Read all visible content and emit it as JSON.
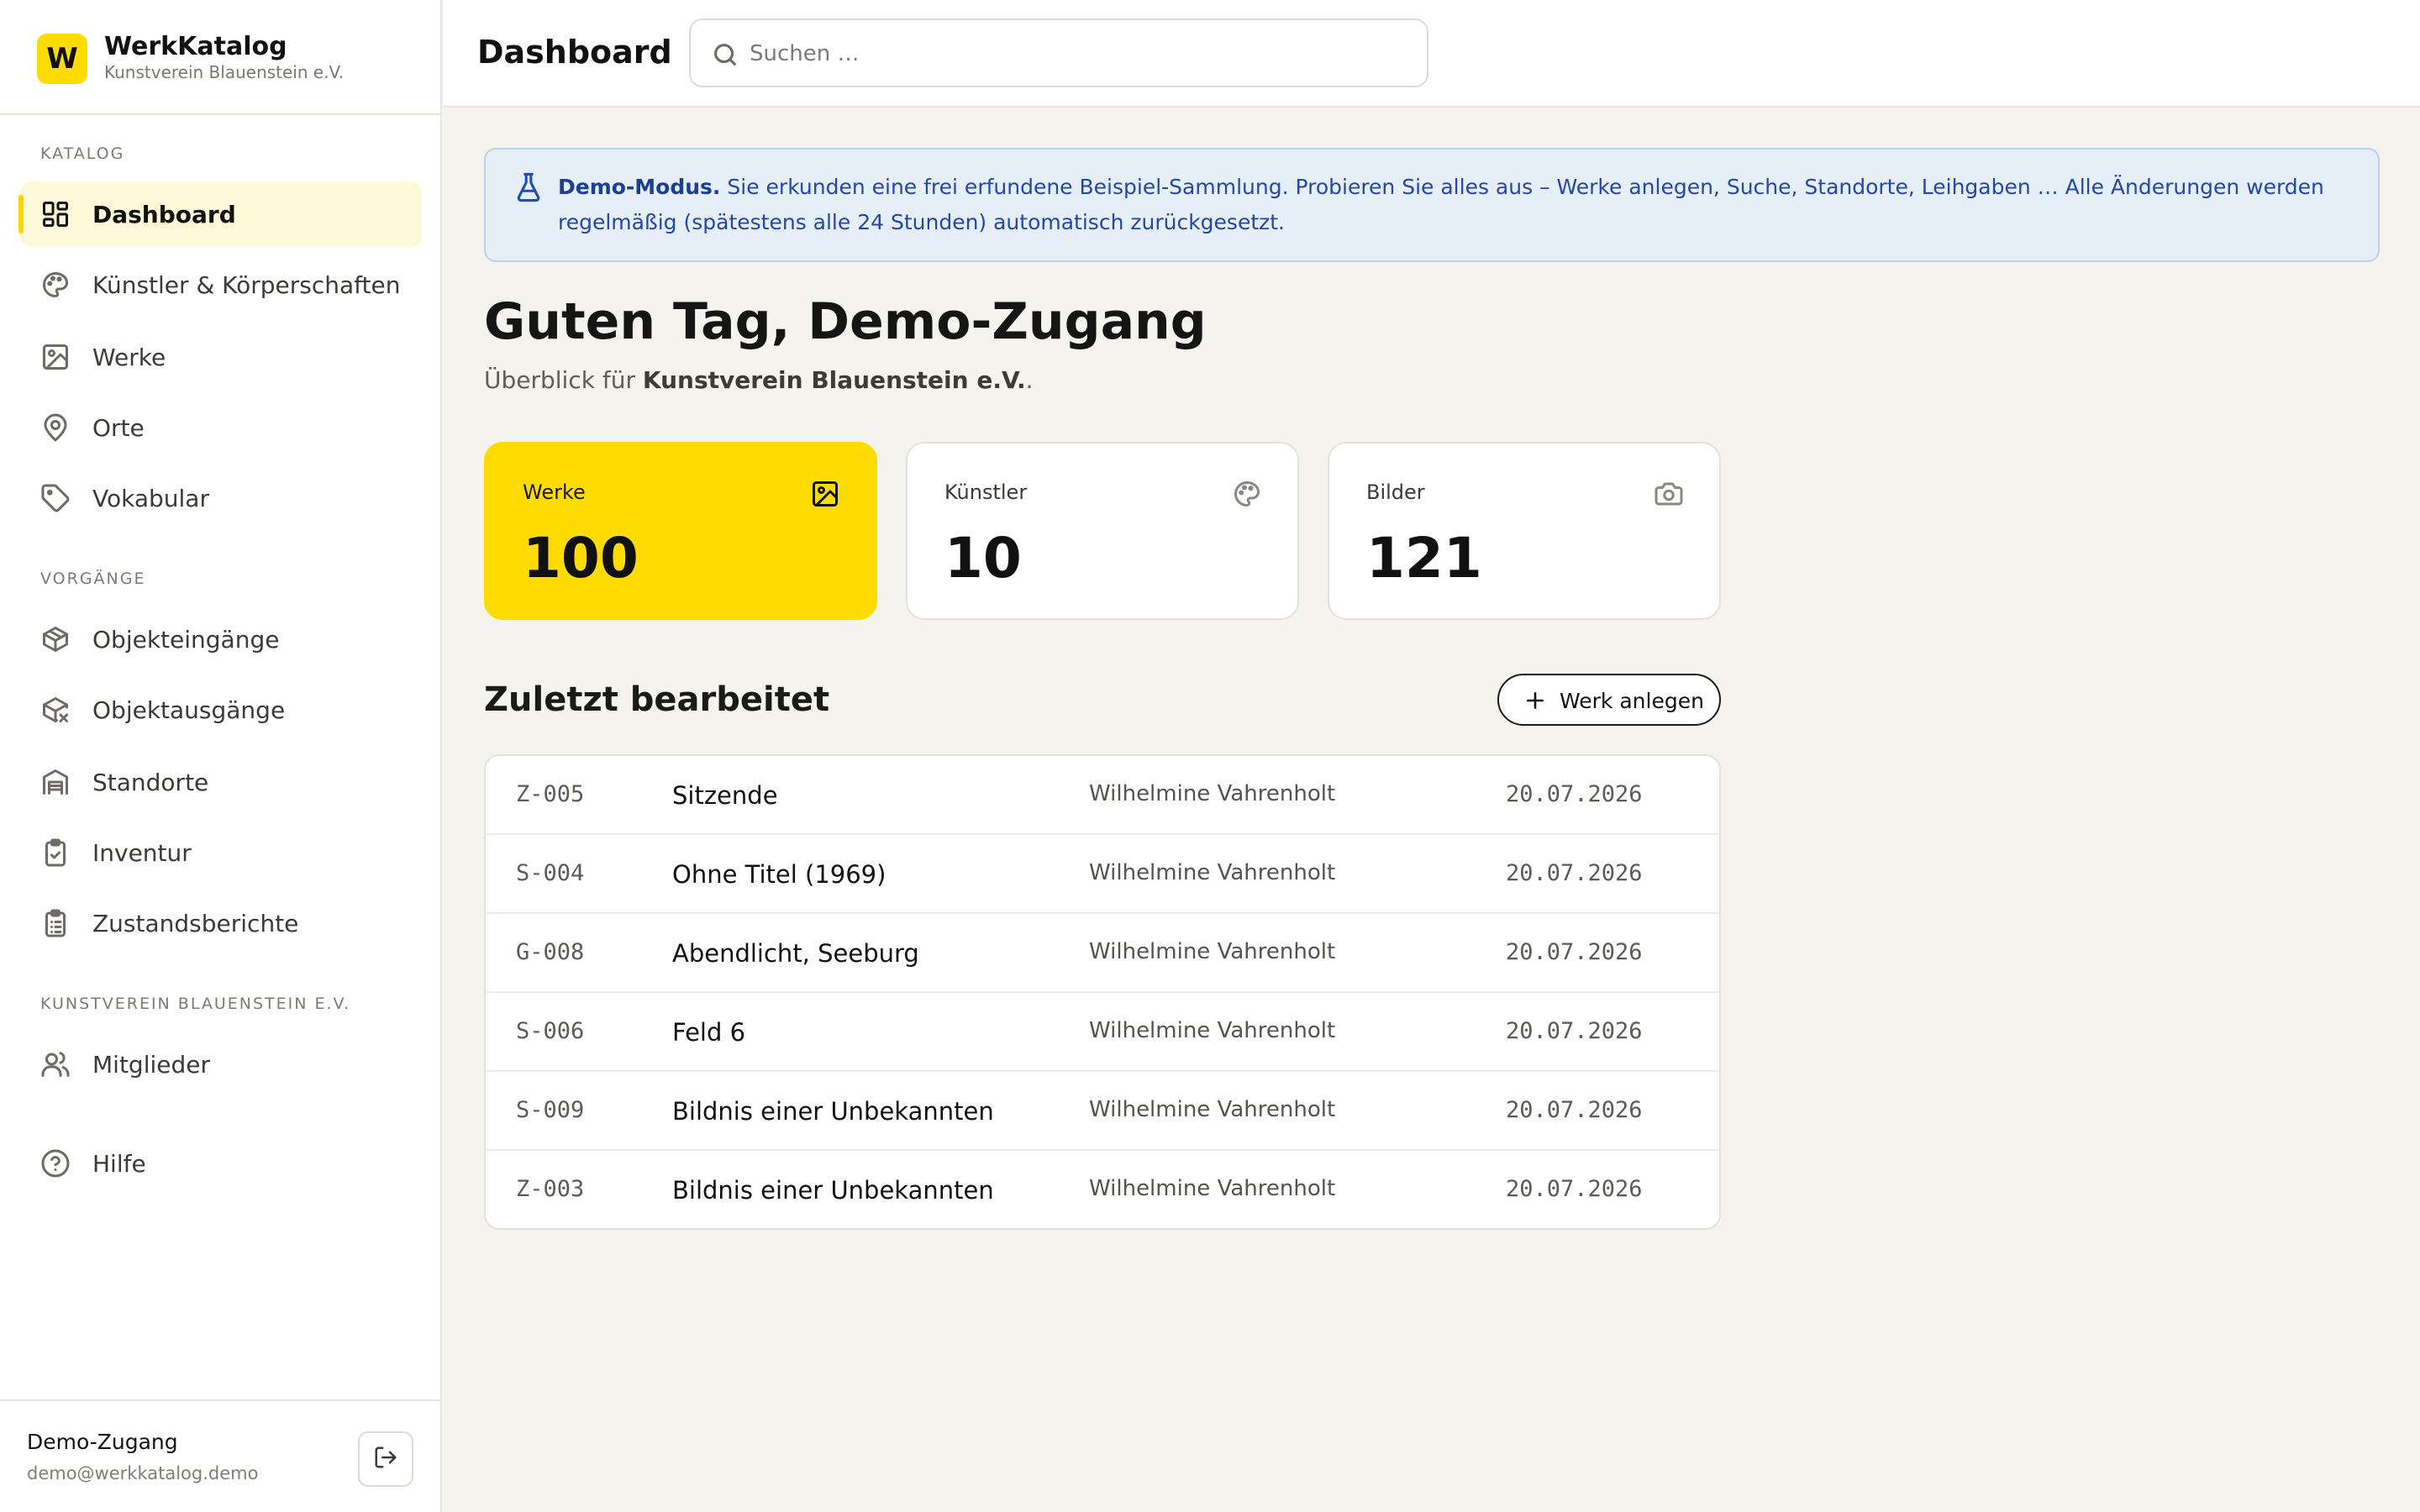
{
  "brand": {
    "logo_letter": "W",
    "name": "WerkKatalog",
    "org": "Kunstverein Blauenstein e.V."
  },
  "sidebar": {
    "sections": [
      {
        "title": "KATALOG"
      },
      {
        "title": "VORGÄNGE"
      },
      {
        "title": "KUNSTVEREIN BLAUENSTEIN E.V."
      }
    ],
    "items": [
      {
        "label": "Dashboard",
        "icon": "dashboard-grid-icon",
        "active": true
      },
      {
        "label": "Künstler & Körperschaften",
        "icon": "palette-icon"
      },
      {
        "label": "Werke",
        "icon": "image-icon"
      },
      {
        "label": "Orte",
        "icon": "map-pin-icon"
      },
      {
        "label": "Vokabular",
        "icon": "tag-icon"
      },
      {
        "label": "Objekteingänge",
        "icon": "package-in-icon"
      },
      {
        "label": "Objektausgänge",
        "icon": "package-out-icon"
      },
      {
        "label": "Standorte",
        "icon": "warehouse-icon"
      },
      {
        "label": "Inventur",
        "icon": "clipboard-check-icon"
      },
      {
        "label": "Zustandsberichte",
        "icon": "clipboard-list-icon"
      },
      {
        "label": "Mitglieder",
        "icon": "users-icon"
      },
      {
        "label": "Hilfe",
        "icon": "help-circle-icon"
      }
    ],
    "user": {
      "name": "Demo-Zugang",
      "email": "demo@werkkatalog.demo",
      "logout_icon": "logout-icon"
    }
  },
  "header": {
    "title": "Dashboard",
    "search_placeholder": "Suchen …"
  },
  "banner": {
    "strong": "Demo-Modus.",
    "text": "Sie erkunden eine frei erfundene Beispiel-Sammlung. Probieren Sie alles aus – Werke anlegen, Suche, Standorte, Leihgaben … Alle Änderungen werden regelmäßig (spätestens alle 24 Stunden) automatisch zurückgesetzt.",
    "icon": "flask-icon"
  },
  "greeting": {
    "title": "Guten Tag, Demo-Zugang",
    "sub_prefix": "Überblick für ",
    "sub_org": "Kunstverein Blauenstein e.V.",
    "sub_suffix": "."
  },
  "stats": [
    {
      "label": "Werke",
      "value": "100",
      "icon": "image-icon"
    },
    {
      "label": "Künstler",
      "value": "10",
      "icon": "palette-icon"
    },
    {
      "label": "Bilder",
      "value": "121",
      "icon": "camera-icon"
    }
  ],
  "recent": {
    "title": "Zuletzt bearbeitet",
    "add_label": "Werk anlegen",
    "rows": [
      {
        "id": "Z-005",
        "title": "Sitzende",
        "author": "Wilhelmine Vahrenholt",
        "date": "20.07.2026"
      },
      {
        "id": "S-004",
        "title": "Ohne Titel (1969)",
        "author": "Wilhelmine Vahrenholt",
        "date": "20.07.2026"
      },
      {
        "id": "G-008",
        "title": "Abendlicht, Seeburg",
        "author": "Wilhelmine Vahrenholt",
        "date": "20.07.2026"
      },
      {
        "id": "S-006",
        "title": "Feld 6",
        "author": "Wilhelmine Vahrenholt",
        "date": "20.07.2026"
      },
      {
        "id": "S-009",
        "title": "Bildnis einer Unbekannten",
        "author": "Wilhelmine Vahrenholt",
        "date": "20.07.2026"
      },
      {
        "id": "Z-003",
        "title": "Bildnis einer Unbekannten",
        "author": "Wilhelmine Vahrenholt",
        "date": "20.07.2026"
      }
    ]
  },
  "colors": {
    "accent": "#ffdc00",
    "banner_bg": "#e6eef7",
    "banner_text": "#2348a8",
    "page_bg": "#f4f3ee"
  }
}
